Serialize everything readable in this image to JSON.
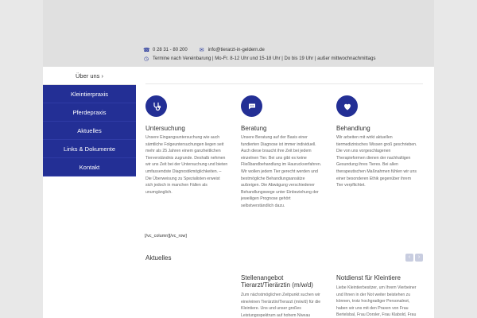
{
  "header": {
    "phone": "0 28 31 - 80 200",
    "email": "info@tierarzt-in-geldern.de",
    "hours": "Termine nach Vereinbarung  |  Mo-Fr. 8-12 Uhr und 15-18 Uhr  |  Do bis 19 Uhr  |  außer mittwochnachmittags"
  },
  "sidebar": {
    "items": [
      {
        "label": "Über uns ›"
      },
      {
        "label": "Kleintierpraxis"
      },
      {
        "label": "Pferdepraxis"
      },
      {
        "label": "Aktuelles"
      },
      {
        "label": "Links & Dokumente"
      },
      {
        "label": "Kontakt"
      }
    ]
  },
  "services": [
    {
      "icon": "stethoscope-icon",
      "title": "Untersuchung",
      "text": "Unsere Eingangsuntersuchung wie auch sämtliche Folgeuntersuchungen liegen seit mehr als 25 Jahren einem ganzheitlichen Tierverständnis zugrunde. Deshalb nehmen wir uns Zeit bei der Untersuchung und bieten umfassendste Diagnostikmöglichkeiten. – Die Überweisung zu Spezialisten erweist sich jedoch in manchen Fällen als unumgänglich."
    },
    {
      "icon": "chat-icon",
      "title": "Beratung",
      "text": "Unsere Beratung auf der Basis einer fundierten Diagnose ist immer individuell. Auch diese braucht ihre Zeit bei jedem einzelnen Tier. Bei uns gibt es keine Fließbandbehandlung im Hauruckverfahren. Wir wollen jedem Tier gerecht werden und bestmögliche Behandlungsansätze aufzeigen. Die Abwägung verschiedener Behandlungswege unter Einbeziehung der jeweiligen Prognose gehört selbstverständlich dazu."
    },
    {
      "icon": "heart-icon",
      "title": "Behandlung",
      "text": "Wir arbeiten mit wirkt aktuellen tiermedizinisches Wissen groß geschrieben. Die von uns vorgeschlagenen Therapieformen dienen der nachhaltigen Gesundung ihres Tieres. Bei allen therapeutischen Maßnahmen fühlen wir uns einer besonderen Ethik gegenüber ihrem Tier verpflichtet."
    }
  ],
  "shortcode": "[/vc_column][/vc_row]",
  "news_section": {
    "title": "Aktuelles",
    "prev": "‹",
    "next": "›"
  },
  "news": [
    {
      "title": "Stellenangebot Tierarzt/Tierärztin (m/w/d)",
      "text": "Zum nächstmöglichen Zeitpunkt suchen wir eine/einen Tierärztin/Tierarzt (m/w/d) für die Kleintiere. Uns und unser großes Leistungsspektrum auf hohem Niveau"
    },
    {
      "title": "Notdienst für Kleintiere",
      "text": "Liebe Kleintierbesitzer, um Ihrem Vierbeiner und Ihnen in der Not weiter beistehen zu können, trotz hochgradiger Personalnot, haben wir uns mit den Praxen von Frau Bertelsbal, Frau Dorsler, Frau Klabold, Frau"
    }
  ],
  "colors": {
    "accent": "#232f95",
    "topbar": "#e0e0e0",
    "background": "#e8e8e8"
  }
}
